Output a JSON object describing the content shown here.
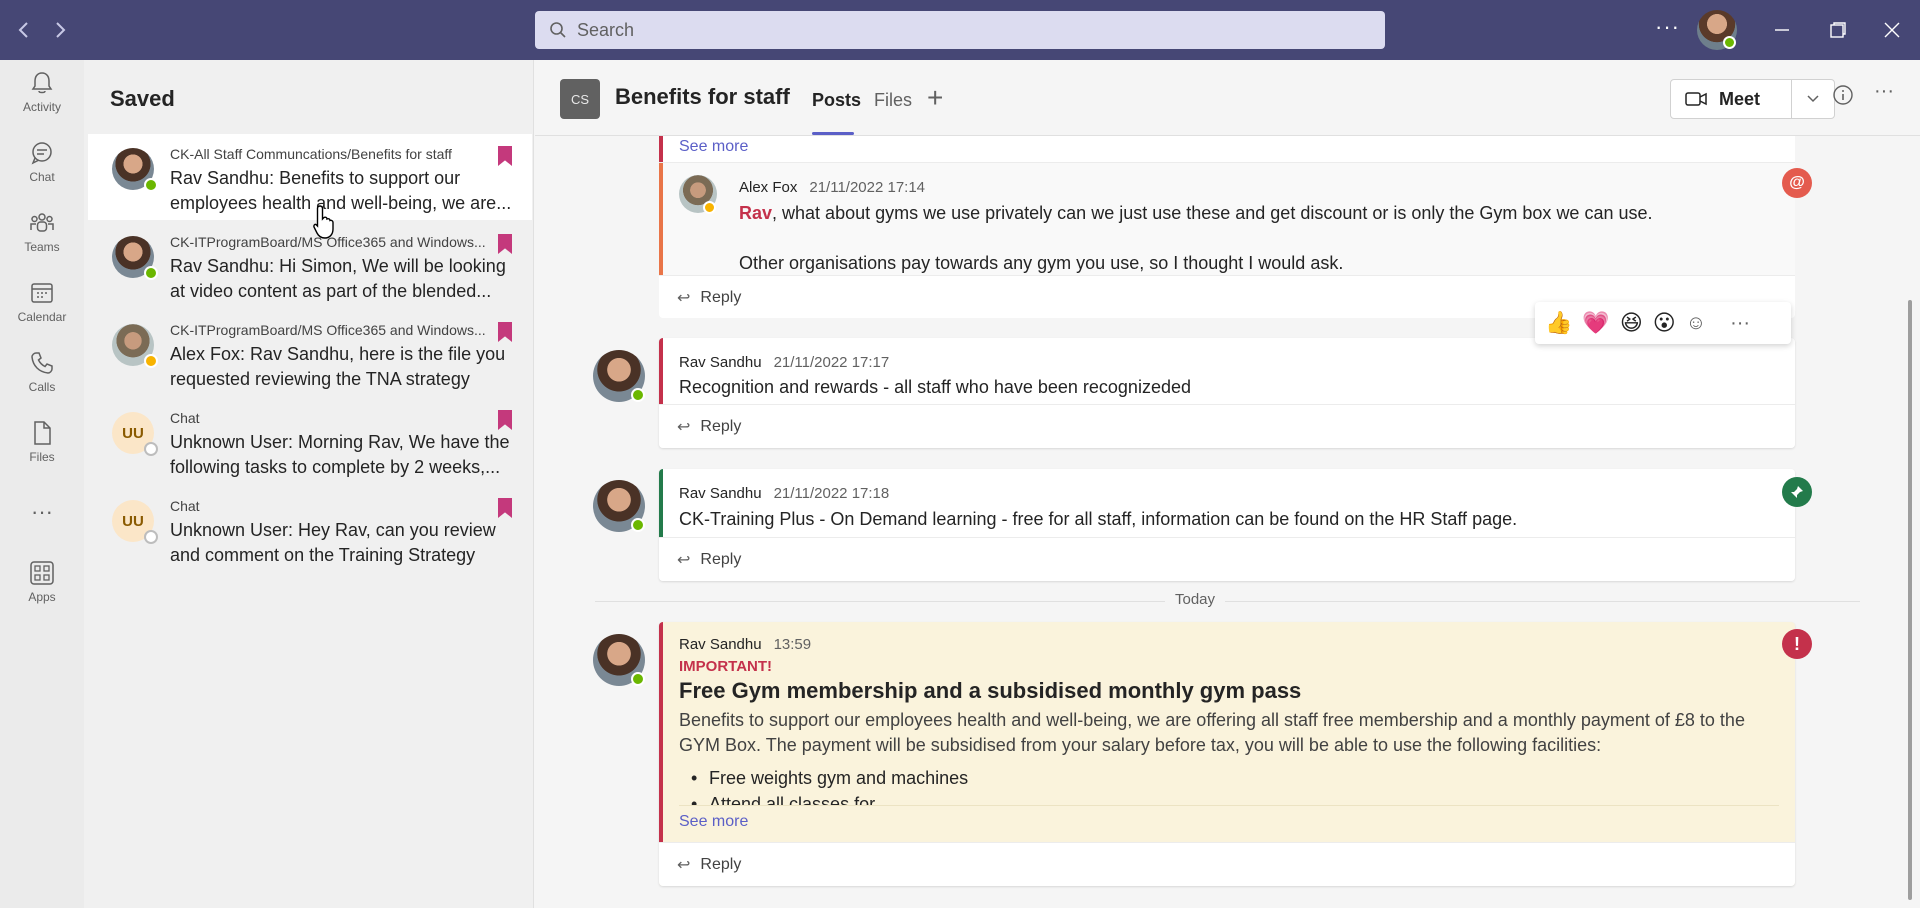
{
  "titlebar": {
    "search_placeholder": "Search",
    "more_label": "···"
  },
  "rail": {
    "items": [
      {
        "label": "Activity",
        "icon": "bell-icon"
      },
      {
        "label": "Chat",
        "icon": "chat-icon"
      },
      {
        "label": "Teams",
        "icon": "teams-icon"
      },
      {
        "label": "Calendar",
        "icon": "calendar-icon"
      },
      {
        "label": "Calls",
        "icon": "phone-icon"
      },
      {
        "label": "Files",
        "icon": "file-icon"
      },
      {
        "label": "···",
        "icon": "more-icon"
      },
      {
        "label": "Apps",
        "icon": "apps-icon"
      }
    ]
  },
  "saved": {
    "title": "Saved",
    "items": [
      {
        "context": "CK-All Staff Communcations/Benefits for staff",
        "message": "Rav Sandhu: Benefits to support our employees health and well-being, we are...",
        "avatar": "rav",
        "status": "available"
      },
      {
        "context": "CK-ITProgramBoard/MS Office365 and Windows...",
        "message": "Rav Sandhu: Hi Simon, We will be looking at video content as part of the blended...",
        "avatar": "rav",
        "status": "available"
      },
      {
        "context": "CK-ITProgramBoard/MS Office365 and Windows...",
        "message": "Alex Fox: Rav Sandhu, here is the file you requested reviewing the TNA strategy and...",
        "avatar": "alex",
        "status": "away"
      },
      {
        "context": "Chat",
        "message": "Unknown User: Morning Rav, We have the following tasks to complete by 2 weeks,...",
        "avatar": "UU",
        "status": "offline"
      },
      {
        "context": "Chat",
        "message": "Unknown User: Hey Rav, can you review and comment on the Training Strategy and...",
        "avatar": "UU",
        "status": "offline"
      }
    ]
  },
  "channel": {
    "team_initials": "CS",
    "name": "Benefits for staff",
    "tabs": [
      "Posts",
      "Files"
    ],
    "active_tab": "Posts",
    "meet_label": "Meet"
  },
  "posts": {
    "see_more": "See more",
    "reply": "Reply",
    "today": "Today",
    "reply_alex": {
      "author": "Alex Fox",
      "time": "21/11/2022 17:14",
      "mention": "Rav",
      "line1": ", what about gyms we use privately can we just use these and get discount or is only the Gym box we can use.",
      "line2": "Other organisations pay towards any gym you use, so I thought I would ask."
    },
    "post1": {
      "author": "Rav Sandhu",
      "time": "21/11/2022 17:17",
      "text": "Recognition and rewards - all staff  who have been recognizeded"
    },
    "post2": {
      "author": "Rav Sandhu",
      "time": "21/11/2022 17:18",
      "text": "CK-Training Plus - On Demand learning - free for all staff, information can be found on the HR Staff page."
    },
    "post3": {
      "author": "Rav Sandhu",
      "time": "13:59",
      "important": "IMPORTANT!",
      "title": "Free Gym membership and a subsidised monthly gym pass",
      "body": "Benefits to support our employees health and well-being, we are offering all staff free membership and a monthly payment of £8 to the GYM Box. The payment will be subsidised from your salary before tax, you will be able to use the following facilities:",
      "bullet1": "Free weights gym and machines",
      "bullet2": "Attend all classes for..."
    },
    "reactions": [
      "👍",
      "💗",
      "😆",
      "😮"
    ]
  },
  "colors": {
    "titlebar": "#464775",
    "accent": "#5b5fc7",
    "bookmark": "#c4397c",
    "important": "#c4314b",
    "mention_bar": "#e97548",
    "recognition_bar": "#c4314b",
    "pinned_bar": "#237b4b"
  }
}
